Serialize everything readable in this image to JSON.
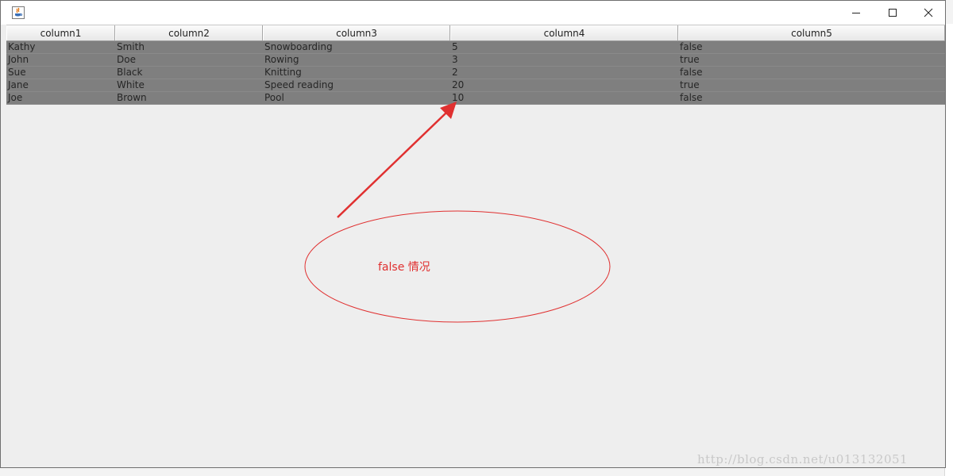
{
  "table": {
    "headers": [
      "column1",
      "column2",
      "column3",
      "column4",
      "column5"
    ],
    "rows": [
      [
        "Kathy",
        "Smith",
        "Snowboarding",
        "5",
        "false"
      ],
      [
        "John",
        "Doe",
        "Rowing",
        "3",
        "true"
      ],
      [
        "Sue",
        "Black",
        "Knitting",
        "2",
        "false"
      ],
      [
        "Jane",
        "White",
        "Speed reading",
        "20",
        "true"
      ],
      [
        "Joe",
        "Brown",
        "Pool",
        "10",
        "false"
      ]
    ]
  },
  "annotation": {
    "text": "false 情况",
    "color": "#e03030"
  },
  "watermark": {
    "text": "http://blog.csdn.net/u013132051"
  },
  "window": {
    "icon": "java-icon",
    "buttons": [
      "minimize-icon",
      "maximize-icon",
      "close-icon"
    ]
  },
  "colors": {
    "selection_bg": "#7f7f7f",
    "window_bg": "#eeeeee",
    "annotation_red": "#e03030"
  }
}
